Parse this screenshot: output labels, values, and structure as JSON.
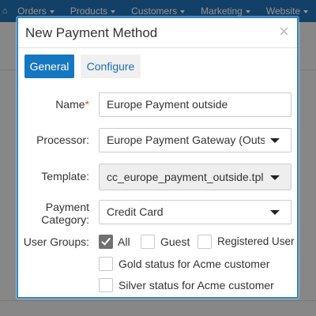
{
  "background_nav": {
    "home_icon": "home-icon",
    "items": [
      {
        "label": "Orders"
      },
      {
        "label": "Products"
      },
      {
        "label": "Customers"
      },
      {
        "label": "Marketing"
      },
      {
        "label": "Website"
      }
    ]
  },
  "modal": {
    "title": "New Payment Method",
    "close_symbol": "×",
    "tabs": [
      {
        "label": "General",
        "active": true
      },
      {
        "label": "Configure",
        "active": false
      }
    ],
    "form": {
      "name": {
        "label": "Name",
        "required_marker": "*",
        "value": "Europe Payment outside"
      },
      "processor": {
        "label": "Processor:",
        "value": "Europe Payment Gateway (Outs"
      },
      "template": {
        "label": "Template:",
        "value": "cc_europe_payment_outside.tpl"
      },
      "payment_category": {
        "label_line1": "Payment",
        "label_line2": "Category:",
        "value": "Credit Card"
      },
      "user_groups": {
        "label": "User Groups:",
        "options": [
          {
            "label": "All",
            "checked": true
          },
          {
            "label": "Guest",
            "checked": false
          },
          {
            "label": "Registered User",
            "checked": false
          },
          {
            "label": "Gold status for Acme customer",
            "checked": false
          },
          {
            "label": "Silver status for Acme customer",
            "checked": false
          }
        ]
      }
    }
  },
  "colors": {
    "accent": "#1577c1",
    "modal_border": "#2a86d0",
    "nav_bar": "#1f6fb2",
    "required": "#e8492f"
  }
}
